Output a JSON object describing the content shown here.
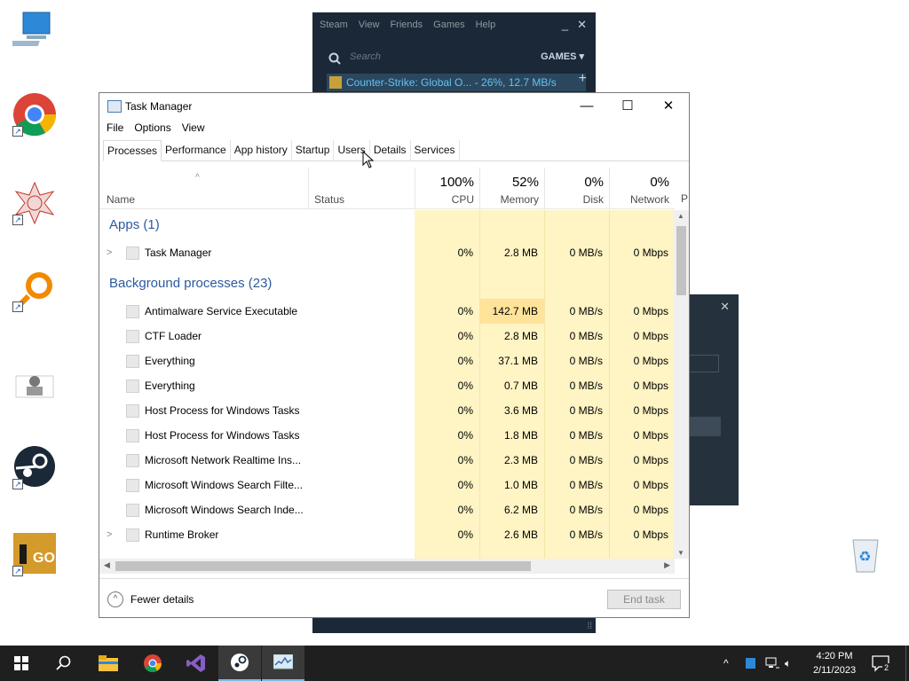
{
  "steam": {
    "menu": [
      "Steam",
      "View",
      "Friends",
      "Games",
      "Help"
    ],
    "search_placeholder": "Search",
    "games_label": "GAMES",
    "download_text": "Counter-Strike: Global O... - 26%, 12.7 MB/s",
    "download_progress_percent": 26,
    "plus": "+"
  },
  "taskmanager": {
    "title": "Task Manager",
    "menu": [
      "File",
      "Options",
      "View"
    ],
    "tabs": [
      "Processes",
      "Performance",
      "App history",
      "Startup",
      "Users",
      "Details",
      "Services"
    ],
    "active_tab": "Processes",
    "columns": {
      "name": "Name",
      "status": "Status",
      "cpu": {
        "pct": "100%",
        "label": "CPU"
      },
      "memory": {
        "pct": "52%",
        "label": "Memory"
      },
      "disk": {
        "pct": "0%",
        "label": "Disk"
      },
      "network": {
        "pct": "0%",
        "label": "Network"
      },
      "power": "P"
    },
    "apps_header": "Apps (1)",
    "apps": [
      {
        "name": "Task Manager",
        "cpu": "0%",
        "mem": "2.8 MB",
        "disk": "0 MB/s",
        "net": "0 Mbps",
        "expand": true
      }
    ],
    "bg_header": "Background processes (23)",
    "background": [
      {
        "name": "Antimalware Service Executable",
        "cpu": "0%",
        "mem": "142.7 MB",
        "disk": "0 MB/s",
        "net": "0 Mbps"
      },
      {
        "name": "CTF Loader",
        "cpu": "0%",
        "mem": "2.8 MB",
        "disk": "0 MB/s",
        "net": "0 Mbps"
      },
      {
        "name": "Everything",
        "cpu": "0%",
        "mem": "37.1 MB",
        "disk": "0 MB/s",
        "net": "0 Mbps"
      },
      {
        "name": "Everything",
        "cpu": "0%",
        "mem": "0.7 MB",
        "disk": "0 MB/s",
        "net": "0 Mbps"
      },
      {
        "name": "Host Process for Windows Tasks",
        "cpu": "0%",
        "mem": "3.6 MB",
        "disk": "0 MB/s",
        "net": "0 Mbps"
      },
      {
        "name": "Host Process for Windows Tasks",
        "cpu": "0%",
        "mem": "1.8 MB",
        "disk": "0 MB/s",
        "net": "0 Mbps"
      },
      {
        "name": "Microsoft Network Realtime Ins...",
        "cpu": "0%",
        "mem": "2.3 MB",
        "disk": "0 MB/s",
        "net": "0 Mbps"
      },
      {
        "name": "Microsoft Windows Search Filte...",
        "cpu": "0%",
        "mem": "1.0 MB",
        "disk": "0 MB/s",
        "net": "0 Mbps"
      },
      {
        "name": "Microsoft Windows Search Inde...",
        "cpu": "0%",
        "mem": "6.2 MB",
        "disk": "0 MB/s",
        "net": "0 Mbps"
      },
      {
        "name": "Runtime Broker",
        "cpu": "0%",
        "mem": "2.6 MB",
        "disk": "0 MB/s",
        "net": "0 Mbps",
        "expand": true
      }
    ],
    "fewer_details": "Fewer details",
    "end_task": "End task"
  },
  "taskbar": {
    "time": "4:20 PM",
    "date": "2/11/2023",
    "notification_count": "2"
  }
}
